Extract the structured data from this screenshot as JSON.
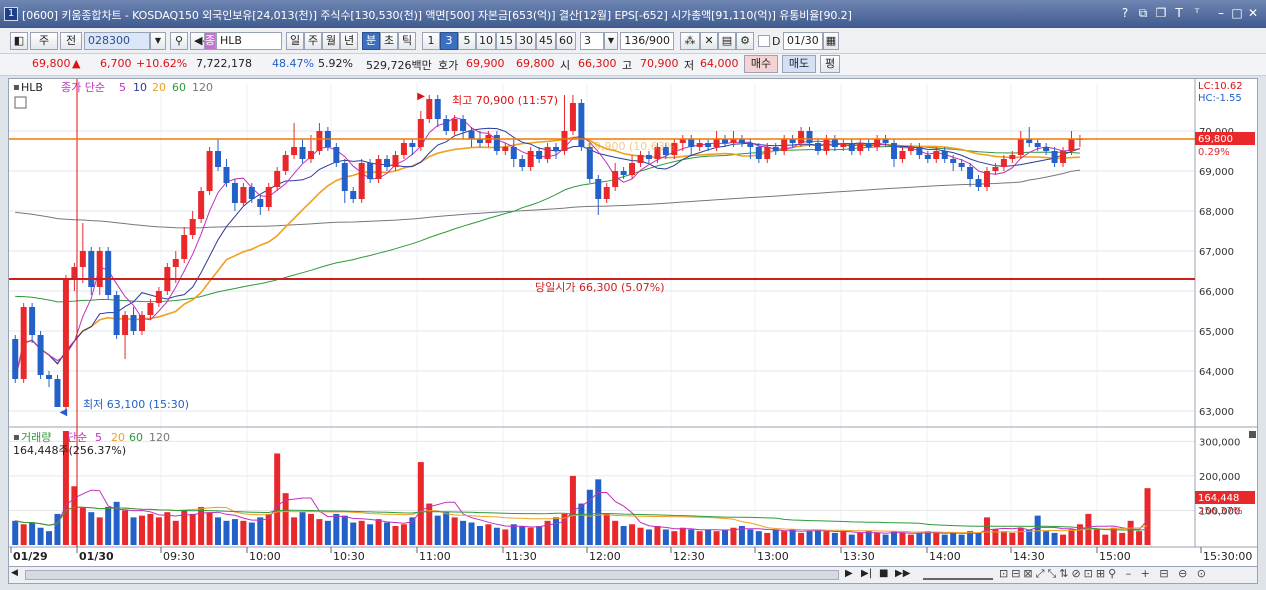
{
  "window": {
    "app_number": "1",
    "title": "[0600] 키움종합차트 - KOSDAQ150 외국인보유[24,013(천)] 주식수[130,530(천)] 액면[500] 자본금[653(억)] 결산[12월] EPS[-652] 시가총액[91,110(억)] 유통비율[90.2]"
  },
  "toolbar": {
    "period_main": "주",
    "period_prev": "전",
    "code": "028300",
    "stock_name": "HLB",
    "period_buttons": [
      "일",
      "주",
      "월",
      "년",
      "분",
      "초",
      "틱"
    ],
    "minute_buttons": [
      "1",
      "3",
      "5",
      "10",
      "15",
      "30",
      "45",
      "60"
    ],
    "minute_select": "3",
    "count": "136/900",
    "date": "01/30",
    "checkbox_label": "D"
  },
  "quote": {
    "price": "69,800",
    "change": "6,700",
    "change_pct": "+10.62%",
    "volume": "7,722,178",
    "ratio1": "48.47%",
    "ratio2": "5.92%",
    "amount": "529,726백만",
    "bid_label": "호가",
    "bid1": "69,900",
    "bid2": "69,800",
    "open_label": "시",
    "open": "66,300",
    "high_label": "고",
    "high": "70,900",
    "low_label": "저",
    "low": "64,000",
    "buy": "매수",
    "sell": "매도",
    "eval": "평"
  },
  "price_panel": {
    "name": "HLB",
    "ma_label": "종가 단순",
    "ma_periods": [
      "5",
      "10",
      "20",
      "60",
      "120"
    ],
    "lc": "LC:10.62",
    "hc": "HC:-1.55",
    "last_price": "69,800",
    "last_pct": "0.29%",
    "high_note": "최고 70,900 (11:57)",
    "low_note": "최저 63,100 (15:30)",
    "open_note": "당일시가 66,300 (5.07%)",
    "faded_note": "69,900 (10.63%)",
    "y_ticks": [
      "70,000",
      "69,000",
      "68,000",
      "67,000",
      "66,000",
      "65,000",
      "64,000",
      "63,000"
    ]
  },
  "volume_panel": {
    "title": "거래량",
    "ma_label": "단순",
    "ma_periods": [
      "5",
      "20",
      "60",
      "120"
    ],
    "info": "164,448주(256.37%)",
    "last_volume": "164,448",
    "last_pct": "256.37%",
    "y_ticks": [
      "300,000",
      "200,000",
      "100,000"
    ]
  },
  "x_axis": {
    "labels": [
      "01/29",
      "01/30",
      "09:30",
      "10:00",
      "10:30",
      "11:00",
      "11:30",
      "12:00",
      "12:30",
      "13:00",
      "13:30",
      "14:00",
      "14:30",
      "15:00",
      "15:30:00"
    ]
  },
  "chart_data": {
    "type": "candlestick",
    "timeframe": "3min",
    "y_range": [
      62700,
      71200
    ],
    "volume_range": [
      0,
      330000
    ],
    "open_line": 66300,
    "high": 70900,
    "low": 63100,
    "last": 69800,
    "colors": {
      "up": "#e8282a",
      "down": "#2360c8",
      "ma5": "#2a3a9a",
      "ma10": "#c030c0",
      "ma20": "#f0a020",
      "ma60": "#2e9a3a",
      "ma120": "#777777",
      "openline": "#cc1f1f",
      "lastline": "#f07800"
    },
    "candles": [
      [
        64800,
        63800,
        64900,
        63700
      ],
      [
        63800,
        65600,
        65700,
        63700
      ],
      [
        65600,
        64900,
        65700,
        64700
      ],
      [
        64900,
        63900,
        65000,
        63800
      ],
      [
        63900,
        63800,
        64000,
        63600
      ],
      [
        63800,
        63100,
        63900,
        63100
      ],
      [
        63100,
        66300,
        66400,
        63000
      ],
      [
        66300,
        66600,
        66700,
        66000
      ],
      [
        66600,
        67000,
        67700,
        66200
      ],
      [
        67000,
        66100,
        67100,
        65900
      ],
      [
        66100,
        67000,
        67100,
        65900
      ],
      [
        67000,
        65900,
        67100,
        65800
      ],
      [
        65900,
        64900,
        66000,
        64800
      ],
      [
        64900,
        65400,
        65500,
        64300
      ],
      [
        65400,
        65000,
        65600,
        64900
      ],
      [
        65000,
        65400,
        65500,
        64900
      ],
      [
        65400,
        65700,
        65800,
        65300
      ],
      [
        65700,
        66000,
        66100,
        65600
      ],
      [
        66000,
        66600,
        66700,
        65900
      ],
      [
        66600,
        66800,
        67000,
        66200
      ],
      [
        66800,
        67400,
        67600,
        66700
      ],
      [
        67400,
        67800,
        68000,
        67300
      ],
      [
        67800,
        68500,
        68600,
        67700
      ],
      [
        68500,
        69500,
        69600,
        68400
      ],
      [
        69500,
        69100,
        69800,
        69000
      ],
      [
        69100,
        68700,
        69300,
        68600
      ],
      [
        68700,
        68200,
        68800,
        68000
      ],
      [
        68200,
        68600,
        68700,
        68100
      ],
      [
        68600,
        68300,
        68700,
        68200
      ],
      [
        68300,
        68100,
        68400,
        67900
      ],
      [
        68100,
        68600,
        68700,
        68000
      ],
      [
        68600,
        69000,
        69100,
        68500
      ],
      [
        69000,
        69400,
        69500,
        68900
      ],
      [
        69400,
        69600,
        70200,
        69300
      ],
      [
        69600,
        69300,
        69800,
        69200
      ],
      [
        69300,
        69500,
        69900,
        69200
      ],
      [
        69500,
        70000,
        70200,
        69400
      ],
      [
        70000,
        69600,
        70100,
        69500
      ],
      [
        69600,
        69200,
        69700,
        69100
      ],
      [
        69200,
        68500,
        69300,
        68200
      ],
      [
        68500,
        68300,
        68600,
        68200
      ],
      [
        68300,
        69200,
        69300,
        68200
      ],
      [
        69200,
        68800,
        69300,
        68700
      ],
      [
        68800,
        69300,
        69400,
        68700
      ],
      [
        69300,
        69100,
        69400,
        69000
      ],
      [
        69100,
        69400,
        69500,
        69000
      ],
      [
        69400,
        69700,
        69800,
        69300
      ],
      [
        69700,
        69600,
        69800,
        69400
      ],
      [
        69600,
        70300,
        70500,
        69500
      ],
      [
        70300,
        70800,
        70900,
        70200
      ],
      [
        70800,
        70300,
        70900,
        70100
      ],
      [
        70300,
        70000,
        70400,
        69900
      ],
      [
        70000,
        70300,
        70400,
        69900
      ],
      [
        70300,
        70000,
        70400,
        69800
      ],
      [
        70000,
        69800,
        70100,
        69600
      ],
      [
        69800,
        69700,
        70000,
        69600
      ],
      [
        69700,
        69900,
        70000,
        69600
      ],
      [
        69900,
        69500,
        70000,
        69400
      ],
      [
        69500,
        69600,
        69700,
        69400
      ],
      [
        69600,
        69300,
        69800,
        69100
      ],
      [
        69300,
        69100,
        69400,
        69000
      ],
      [
        69100,
        69500,
        69600,
        69000
      ],
      [
        69500,
        69300,
        69600,
        69200
      ],
      [
        69300,
        69600,
        69700,
        69200
      ],
      [
        69600,
        69500,
        69700,
        69300
      ],
      [
        69500,
        70000,
        70900,
        69400
      ],
      [
        70000,
        70700,
        70900,
        69900
      ],
      [
        70700,
        69600,
        70800,
        69500
      ],
      [
        69600,
        68800,
        69700,
        68700
      ],
      [
        68800,
        68300,
        68900,
        67900
      ],
      [
        68300,
        68600,
        68700,
        68200
      ],
      [
        68600,
        69000,
        69200,
        68500
      ],
      [
        69000,
        68900,
        69100,
        68800
      ],
      [
        68900,
        69200,
        69400,
        68800
      ],
      [
        69200,
        69400,
        69500,
        69100
      ],
      [
        69400,
        69300,
        69500,
        69200
      ],
      [
        69300,
        69600,
        69700,
        69200
      ],
      [
        69600,
        69400,
        69700,
        69300
      ],
      [
        69400,
        69700,
        69800,
        69300
      ],
      [
        69700,
        69800,
        69900,
        69500
      ],
      [
        69800,
        69600,
        69900,
        69400
      ],
      [
        69600,
        69700,
        69800,
        69500
      ],
      [
        69700,
        69600,
        69800,
        69500
      ],
      [
        69600,
        69800,
        70000,
        69500
      ],
      [
        69800,
        69700,
        69900,
        69600
      ],
      [
        69700,
        69800,
        70000,
        69600
      ],
      [
        69800,
        69700,
        69900,
        69600
      ],
      [
        69700,
        69600,
        69800,
        69300
      ],
      [
        69600,
        69300,
        69700,
        69200
      ],
      [
        69300,
        69600,
        69700,
        69200
      ],
      [
        69600,
        69500,
        69700,
        69400
      ],
      [
        69500,
        69800,
        69900,
        69400
      ],
      [
        69800,
        69700,
        69900,
        69600
      ],
      [
        69700,
        70000,
        70100,
        69600
      ],
      [
        70000,
        69700,
        70100,
        69600
      ],
      [
        69700,
        69500,
        69800,
        69400
      ],
      [
        69500,
        69800,
        69900,
        69400
      ],
      [
        69800,
        69600,
        69900,
        69500
      ],
      [
        69600,
        69700,
        69800,
        69500
      ],
      [
        69700,
        69500,
        69800,
        69400
      ],
      [
        69500,
        69700,
        69800,
        69400
      ],
      [
        69700,
        69600,
        69800,
        69500
      ],
      [
        69600,
        69800,
        69900,
        69500
      ],
      [
        69800,
        69700,
        69900,
        69600
      ],
      [
        69700,
        69300,
        69800,
        69100
      ],
      [
        69300,
        69500,
        69600,
        69200
      ],
      [
        69500,
        69600,
        69700,
        69400
      ],
      [
        69600,
        69400,
        69700,
        69300
      ],
      [
        69400,
        69300,
        69500,
        69200
      ],
      [
        69300,
        69500,
        69600,
        69200
      ],
      [
        69500,
        69300,
        69600,
        69200
      ],
      [
        69300,
        69200,
        69400,
        69000
      ],
      [
        69200,
        69100,
        69300,
        69000
      ],
      [
        69100,
        68800,
        69200,
        68600
      ],
      [
        68800,
        68600,
        68900,
        68500
      ],
      [
        68600,
        69000,
        69100,
        68500
      ],
      [
        69000,
        69100,
        69200,
        68900
      ],
      [
        69100,
        69300,
        69400,
        69000
      ],
      [
        69300,
        69400,
        69500,
        69200
      ],
      [
        69400,
        69800,
        70000,
        69300
      ],
      [
        69800,
        69700,
        70100,
        69600
      ],
      [
        69700,
        69600,
        69800,
        69500
      ],
      [
        69600,
        69500,
        69700,
        69400
      ],
      [
        69500,
        69200,
        69600,
        69100
      ],
      [
        69200,
        69500,
        69600,
        69100
      ],
      [
        69500,
        69800,
        70000,
        69400
      ],
      [
        69800,
        69800,
        69900,
        69600
      ]
    ],
    "volumes": [
      70000,
      60000,
      65000,
      50000,
      40000,
      90000,
      330000,
      170000,
      110000,
      95000,
      80000,
      110000,
      125000,
      100000,
      80000,
      85000,
      90000,
      80000,
      95000,
      70000,
      100000,
      90000,
      110000,
      95000,
      80000,
      70000,
      75000,
      70000,
      65000,
      80000,
      90000,
      265000,
      150000,
      80000,
      95000,
      90000,
      75000,
      70000,
      90000,
      85000,
      65000,
      70000,
      60000,
      75000,
      65000,
      55000,
      60000,
      80000,
      240000,
      120000,
      85000,
      95000,
      80000,
      70000,
      65000,
      55000,
      60000,
      50000,
      45000,
      60000,
      55000,
      50000,
      55000,
      70000,
      80000,
      90000,
      200000,
      120000,
      160000,
      190000,
      90000,
      70000,
      55000,
      60000,
      50000,
      45000,
      55000,
      45000,
      40000,
      50000,
      45000,
      40000,
      45000,
      40000,
      45000,
      50000,
      55000,
      45000,
      40000,
      35000,
      45000,
      40000,
      45000,
      35000,
      40000,
      45000,
      40000,
      35000,
      40000,
      30000,
      35000,
      40000,
      35000,
      30000,
      40000,
      35000,
      30000,
      35000,
      40000,
      35000,
      30000,
      35000,
      30000,
      40000,
      35000,
      80000,
      45000,
      40000,
      35000,
      50000,
      45000,
      85000,
      40000,
      35000,
      30000,
      45000,
      60000,
      90000,
      45000,
      30000,
      50000,
      35000,
      70000,
      40000,
      164448
    ],
    "ma_series": {
      "ma60_start": 65900,
      "ma120_start": 68000
    }
  }
}
